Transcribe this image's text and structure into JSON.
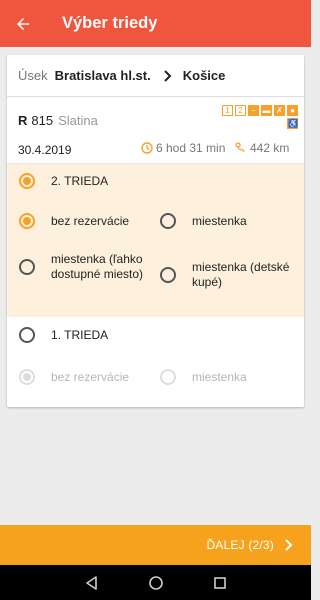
{
  "appbar": {
    "title": "Výber triedy",
    "back_icon": "arrow-left-icon"
  },
  "route": {
    "label": "Úsek",
    "from": "Bratislava hl.st.",
    "to": "Košice"
  },
  "train": {
    "type": "R",
    "number": "815",
    "name": "Slatina",
    "date": "30.4.2019",
    "duration": "6 hod 31 min",
    "distance": "442 km",
    "amenities": [
      "1",
      "2",
      "couchette-icon",
      "bed-icon",
      "dining-icon",
      "bicycle-icon",
      "wheelchair-icon"
    ]
  },
  "classes": [
    {
      "label": "2. TRIEDA",
      "selected": true,
      "options": [
        {
          "label": "bez rezervácie",
          "selected": true
        },
        {
          "label": "miestenka",
          "selected": false
        },
        {
          "label": "miestenka (ľahko dostupné miesto)",
          "selected": false
        },
        {
          "label": "miestenka (detské kupé)",
          "selected": false
        }
      ]
    },
    {
      "label": "1. TRIEDA",
      "selected": false,
      "options": [
        {
          "label": "bez rezervácie",
          "selected": true
        },
        {
          "label": "miestenka",
          "selected": false
        }
      ]
    }
  ],
  "footer": {
    "next_label": "ĎALEJ (2/3)",
    "next_icon": "chevron-right-icon"
  },
  "colors": {
    "primary": "#f0553d",
    "accent": "#f7a21c",
    "highlight": "#fdf1dd"
  },
  "system_nav": [
    "back-icon",
    "home-icon",
    "recents-icon"
  ]
}
